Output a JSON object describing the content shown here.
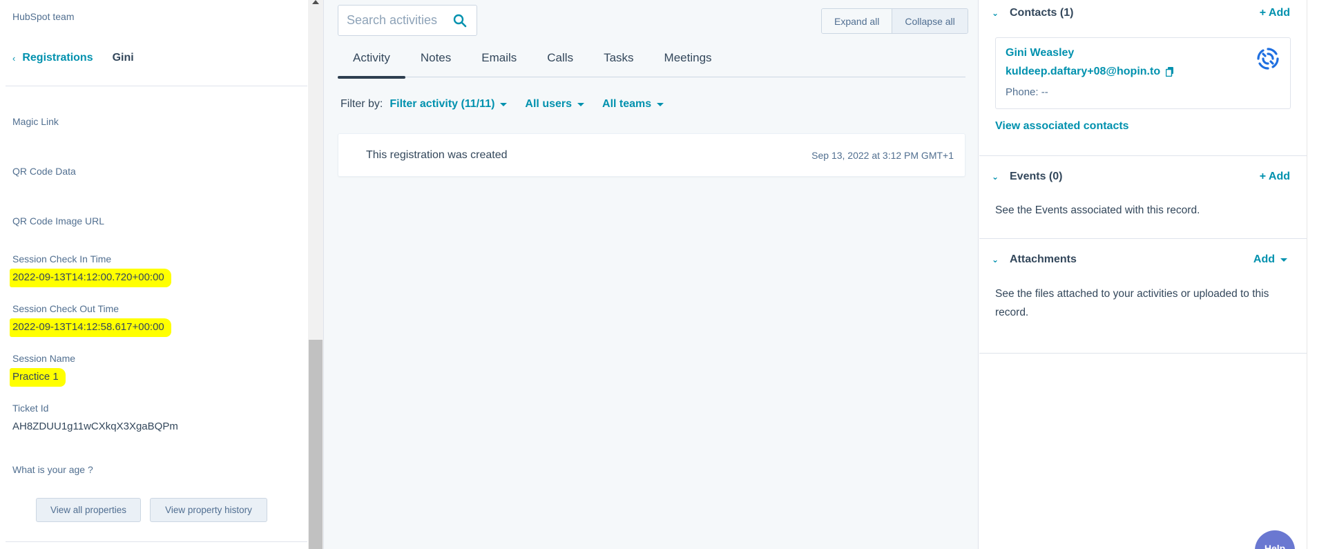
{
  "left": {
    "team": "HubSpot team",
    "breadcrumb": {
      "parent": "Registrations",
      "current": "Gini"
    },
    "properties": [
      {
        "label": "Magic Link",
        "value": ""
      },
      {
        "label": "QR Code Data",
        "value": ""
      },
      {
        "label": "QR Code Image URL",
        "value": ""
      },
      {
        "label": "Session Check In Time",
        "value": "2022-09-13T14:12:00.720+00:00"
      },
      {
        "label": "Session Check Out Time",
        "value": "2022-09-13T14:12:58.617+00:00"
      },
      {
        "label": "Session Name",
        "value": "Practice 1"
      },
      {
        "label": "Ticket Id",
        "value": "AH8ZDUU1g11wCXkqX3XgaBQPm"
      },
      {
        "label": "What is your age ?",
        "value": ""
      }
    ],
    "buttons": {
      "view_all": "View all properties",
      "history": "View property history"
    },
    "highlight_color": "#ffff00"
  },
  "center": {
    "search": {
      "placeholder": "Search activities"
    },
    "expand_all": "Expand all",
    "collapse_all": "Collapse all",
    "tabs": [
      "Activity",
      "Notes",
      "Emails",
      "Calls",
      "Tasks",
      "Meetings"
    ],
    "active_tab": "Activity",
    "filter": {
      "label": "Filter by:",
      "activity": "Filter activity (11/11)",
      "users": "All users",
      "teams": "All teams"
    },
    "activity_card": {
      "text": "This registration was created",
      "date": "Sep 13, 2022 at 3:12 PM GMT+1"
    }
  },
  "right": {
    "contacts": {
      "title": "Contacts (1)",
      "add": "+ Add",
      "name": "Gini Weasley",
      "email": "kuldeep.daftary+08@hopin.to",
      "phone": "Phone: --",
      "view_link": "View associated contacts"
    },
    "events": {
      "title": "Events (0)",
      "add": "+ Add",
      "desc": "See the Events associated with this record."
    },
    "attachments": {
      "title": "Attachments",
      "add": "Add",
      "desc_line1": "See the files attached to your activities or uploaded to this",
      "desc_line2": "record."
    }
  },
  "help": {
    "label": "Help"
  },
  "colors": {
    "accent": "#0091ae",
    "text": "#33475b",
    "help": "#6a78d1"
  }
}
